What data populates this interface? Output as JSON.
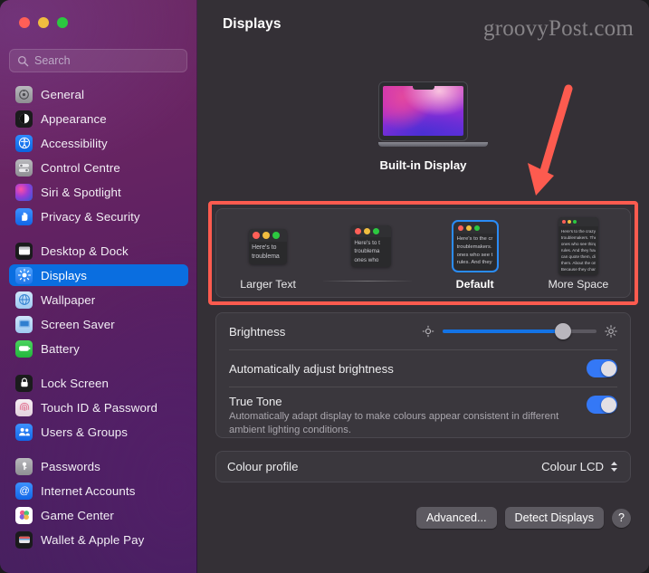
{
  "window": {
    "traffic_lights": [
      "close",
      "minimise",
      "zoom"
    ],
    "accent_blue": "#0a6ee0",
    "annotation_red": "#fd5b4f"
  },
  "sidebar": {
    "search": {
      "placeholder": "Search",
      "value": "",
      "icon": "search-icon"
    },
    "items": [
      {
        "label": "General",
        "icon": "gear-icon",
        "selected": false,
        "group": 0
      },
      {
        "label": "Appearance",
        "icon": "appearance-icon",
        "selected": false,
        "group": 0
      },
      {
        "label": "Accessibility",
        "icon": "accessibility-icon",
        "selected": false,
        "group": 0
      },
      {
        "label": "Control Centre",
        "icon": "control-centre-icon",
        "selected": false,
        "group": 0
      },
      {
        "label": "Siri & Spotlight",
        "icon": "siri-icon",
        "selected": false,
        "group": 0
      },
      {
        "label": "Privacy & Security",
        "icon": "hand-shield-icon",
        "selected": false,
        "group": 0
      },
      {
        "label": "Desktop & Dock",
        "icon": "desktop-dock-icon",
        "selected": false,
        "group": 1
      },
      {
        "label": "Displays",
        "icon": "displays-icon",
        "selected": true,
        "group": 1
      },
      {
        "label": "Wallpaper",
        "icon": "wallpaper-icon",
        "selected": false,
        "group": 1
      },
      {
        "label": "Screen Saver",
        "icon": "screen-saver-icon",
        "selected": false,
        "group": 1
      },
      {
        "label": "Battery",
        "icon": "battery-icon",
        "selected": false,
        "group": 1
      },
      {
        "label": "Lock Screen",
        "icon": "lock-icon",
        "selected": false,
        "group": 2
      },
      {
        "label": "Touch ID & Password",
        "icon": "fingerprint-icon",
        "selected": false,
        "group": 2
      },
      {
        "label": "Users & Groups",
        "icon": "users-icon",
        "selected": false,
        "group": 2
      },
      {
        "label": "Passwords",
        "icon": "key-icon",
        "selected": false,
        "group": 3
      },
      {
        "label": "Internet Accounts",
        "icon": "at-sign-icon",
        "selected": false,
        "group": 3
      },
      {
        "label": "Game Center",
        "icon": "game-center-icon",
        "selected": false,
        "group": 3
      },
      {
        "label": "Wallet & Apple Pay",
        "icon": "wallet-icon",
        "selected": false,
        "group": 3
      }
    ]
  },
  "header": {
    "title": "Displays",
    "watermark": "groovyPost.com"
  },
  "display_preview": {
    "name": "Built-in Display",
    "icon": "macbook-icon"
  },
  "resolution": {
    "selected": "Default",
    "options": [
      {
        "label": "Larger Text",
        "selected": false,
        "scale": 1.3,
        "lines": [
          "Here's to",
          "troublema"
        ]
      },
      {
        "label": "",
        "selected": false,
        "scale": 1.12,
        "lines": [
          "Here's to t",
          "troublema",
          "ones who"
        ]
      },
      {
        "label": "Default",
        "selected": true,
        "scale": 1.0,
        "lines": [
          "Here's to the cr",
          "troublemakers.",
          "ones who see t",
          "rules. And they"
        ]
      },
      {
        "label": "More Space",
        "selected": false,
        "scale": 0.62,
        "lines": [
          "Here's to the crazy one",
          "troublemakers. The rou",
          "ones who see things dif",
          "rules. And they have no",
          "can quote them, disagr",
          "them. About the only th",
          "Because they change th"
        ]
      }
    ]
  },
  "brightness": {
    "label": "Brightness",
    "value_percent": 78,
    "low_icon": "sun-low-icon",
    "high_icon": "sun-high-icon"
  },
  "auto_brightness": {
    "label": "Automatically adjust brightness",
    "enabled": true
  },
  "true_tone": {
    "label": "True Tone",
    "description": "Automatically adapt display to make colours appear consistent in different ambient lighting conditions.",
    "enabled": true
  },
  "colour_profile": {
    "label": "Colour profile",
    "value": "Colour LCD",
    "icon": "chevron-updown-icon"
  },
  "footer": {
    "advanced_label": "Advanced...",
    "detect_label": "Detect Displays",
    "help_label": "?"
  },
  "annotations": {
    "arrow": "red-down-arrow",
    "highlight_box": "red-rectangle-around-resolution-row"
  }
}
